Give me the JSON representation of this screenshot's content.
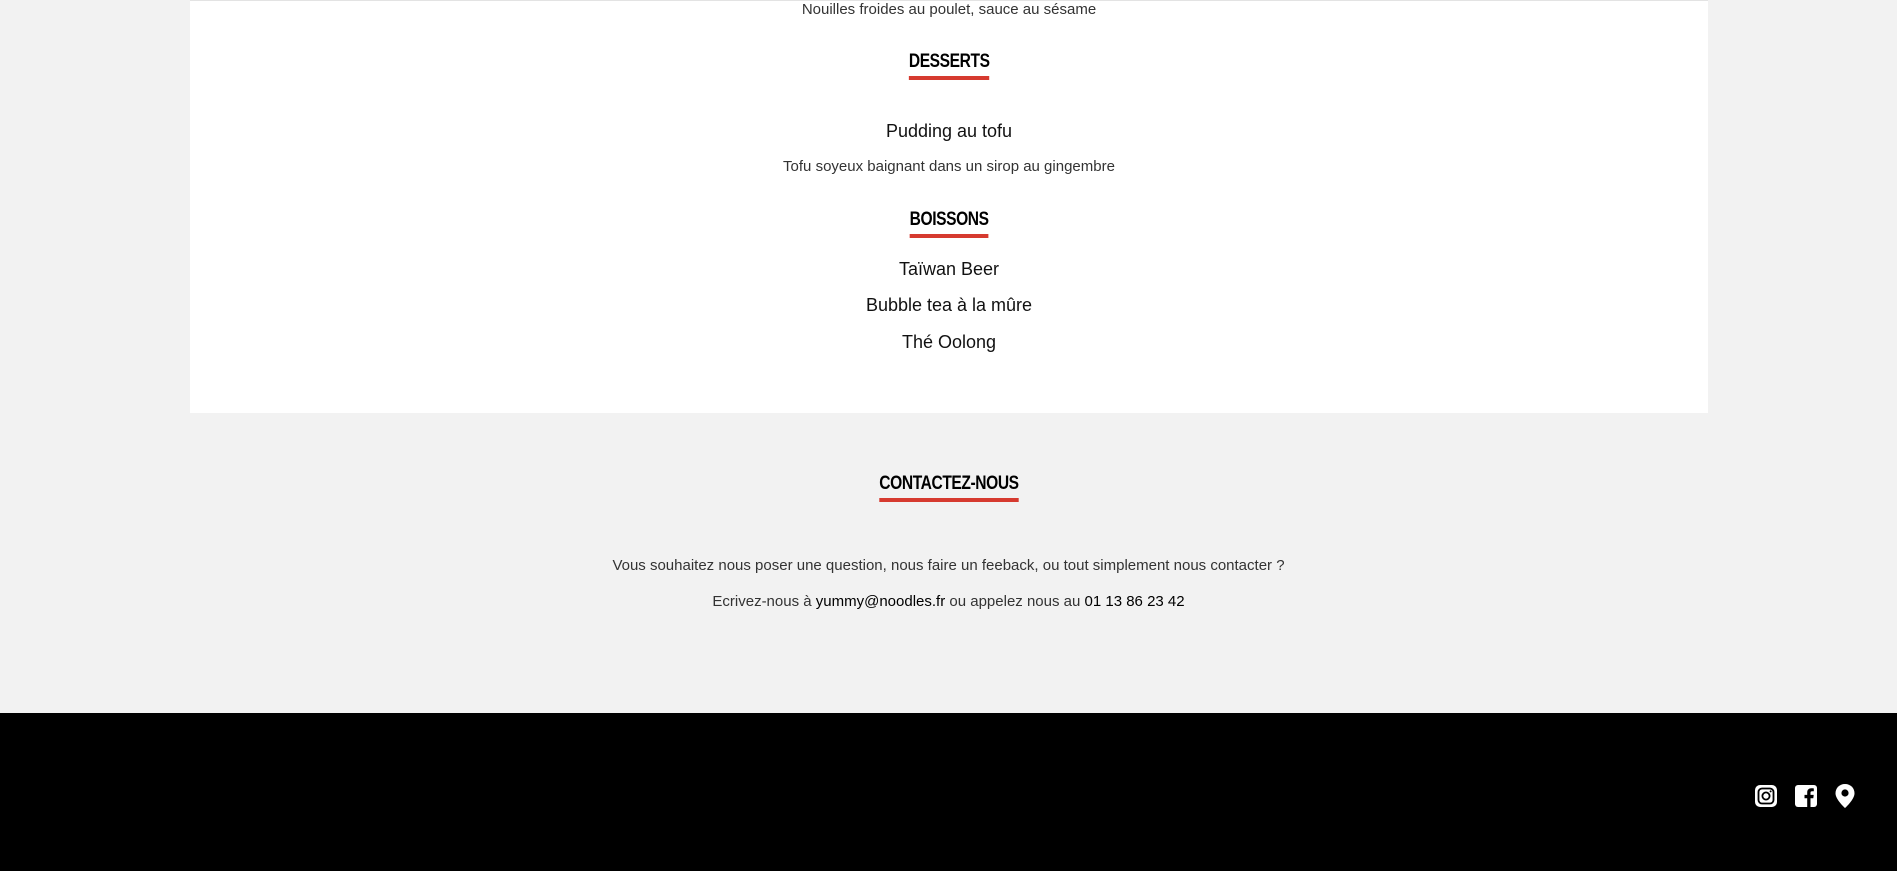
{
  "menu": {
    "prev_item_description": "Nouilles froides au poulet, sauce au sésame",
    "desserts": {
      "heading": "DESSERTS",
      "items": [
        {
          "name": "Pudding au tofu",
          "description": "Tofu soyeux baignant dans un sirop au gingembre"
        }
      ]
    },
    "boissons": {
      "heading": "BOISSONS",
      "items": [
        "Taïwan Beer",
        "Bubble tea à la mûre",
        "Thé Oolong"
      ]
    }
  },
  "contact": {
    "heading": "CONTACTEZ-NOUS",
    "line1": "Vous souhaitez nous poser une question, nous faire un feeback, ou tout simplement nous contacter ?",
    "line2_prefix": "Ecrivez-nous à",
    "email": "yummy@noodles.fr",
    "line2_middle": "ou appelez nous au",
    "phone": "01 13 86 23 42"
  },
  "footer": {
    "icons": [
      "instagram-icon",
      "facebook-icon",
      "map-pin-icon"
    ]
  },
  "colors": {
    "accent": "#d63a2f",
    "page_bg": "#f2f2f2",
    "card_bg": "#ffffff",
    "footer_bg": "#000000"
  }
}
